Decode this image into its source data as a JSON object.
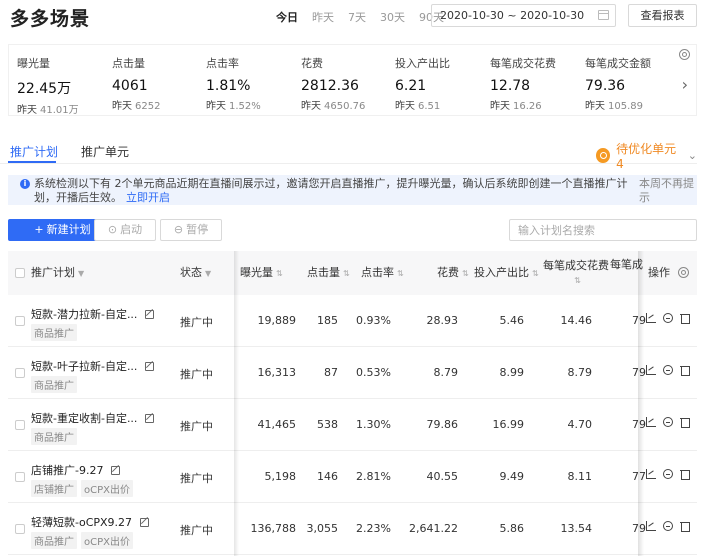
{
  "header": {
    "title": "多多场景",
    "ranges": [
      {
        "label": "今日",
        "active": true
      },
      {
        "label": "昨天",
        "active": false
      },
      {
        "label": "7天",
        "active": false
      },
      {
        "label": "30天",
        "active": false
      },
      {
        "label": "90天",
        "active": false
      }
    ],
    "date_range": "2020-10-30 ~ 2020-10-30",
    "report_button": "查看报表"
  },
  "metrics": [
    {
      "label": "曝光量",
      "value": "22.45万",
      "prev_label": "昨天",
      "prev_value": "41.01万"
    },
    {
      "label": "点击量",
      "value": "4061",
      "prev_label": "昨天",
      "prev_value": "6252"
    },
    {
      "label": "点击率",
      "value": "1.81%",
      "prev_label": "昨天",
      "prev_value": "1.52%"
    },
    {
      "label": "花费",
      "value": "2812.36",
      "prev_label": "昨天",
      "prev_value": "4650.76"
    },
    {
      "label": "投入产出比",
      "value": "6.21",
      "prev_label": "昨天",
      "prev_value": "6.51"
    },
    {
      "label": "每笔成交花费",
      "value": "12.78",
      "prev_label": "昨天",
      "prev_value": "16.26"
    },
    {
      "label": "每笔成交金额",
      "value": "79.36",
      "prev_label": "昨天",
      "prev_value": "105.89"
    }
  ],
  "tabs": [
    {
      "label": "推广计划",
      "active": true
    },
    {
      "label": "推广单元",
      "active": false
    }
  ],
  "optimize_link": "待优化单元4",
  "notice": {
    "text": "系统检测以下有 2个单元商品近期在直播间展示过，邀请您开启直播推广，提升曝光量，确认后系统即创建一个直播推广计划，开播后生效。",
    "link": "立即开启",
    "dismiss": "本周不再提示"
  },
  "toolbar": {
    "new_plan": "新建计划",
    "start": "启动",
    "pause": "暂停",
    "search_placeholder": "输入计划名搜索"
  },
  "table": {
    "headers": {
      "name": "推广计划",
      "status": "状态",
      "impressions": "曝光量",
      "clicks": "点击量",
      "ctr": "点击率",
      "cost": "花费",
      "roi": "投入产出比",
      "cost_per_order": "每笔成交花费",
      "order_amount": "每笔成",
      "ops": "操作"
    },
    "rows": [
      {
        "name": "短款-潜力拉新-自定...",
        "tags": [
          "商品推广"
        ],
        "status": "推广中",
        "impressions": "19,889",
        "clicks": "185",
        "ctr": "0.93%",
        "cost": "28.93",
        "roi": "5.46",
        "cost_per_order": "14.46",
        "order_amount": "79"
      },
      {
        "name": "短款-叶子拉新-自定...",
        "tags": [
          "商品推广"
        ],
        "status": "推广中",
        "impressions": "16,313",
        "clicks": "87",
        "ctr": "0.53%",
        "cost": "8.79",
        "roi": "8.99",
        "cost_per_order": "8.79",
        "order_amount": "79"
      },
      {
        "name": "短款-重定收割-自定...",
        "tags": [
          "商品推广"
        ],
        "status": "推广中",
        "impressions": "41,465",
        "clicks": "538",
        "ctr": "1.30%",
        "cost": "79.86",
        "roi": "16.99",
        "cost_per_order": "4.70",
        "order_amount": "79"
      },
      {
        "name": "店铺推广-9.27",
        "tags": [
          "店铺推广",
          "oCPX出价"
        ],
        "status": "推广中",
        "impressions": "5,198",
        "clicks": "146",
        "ctr": "2.81%",
        "cost": "40.55",
        "roi": "9.49",
        "cost_per_order": "8.11",
        "order_amount": "77"
      },
      {
        "name": "轻薄短款-oCPX9.27",
        "tags": [
          "商品推广",
          "oCPX出价"
        ],
        "status": "推广中",
        "impressions": "136,788",
        "clicks": "3,055",
        "ctr": "2.23%",
        "cost": "2,641.22",
        "roi": "5.86",
        "cost_per_order": "13.54",
        "order_amount": "79"
      }
    ]
  }
}
